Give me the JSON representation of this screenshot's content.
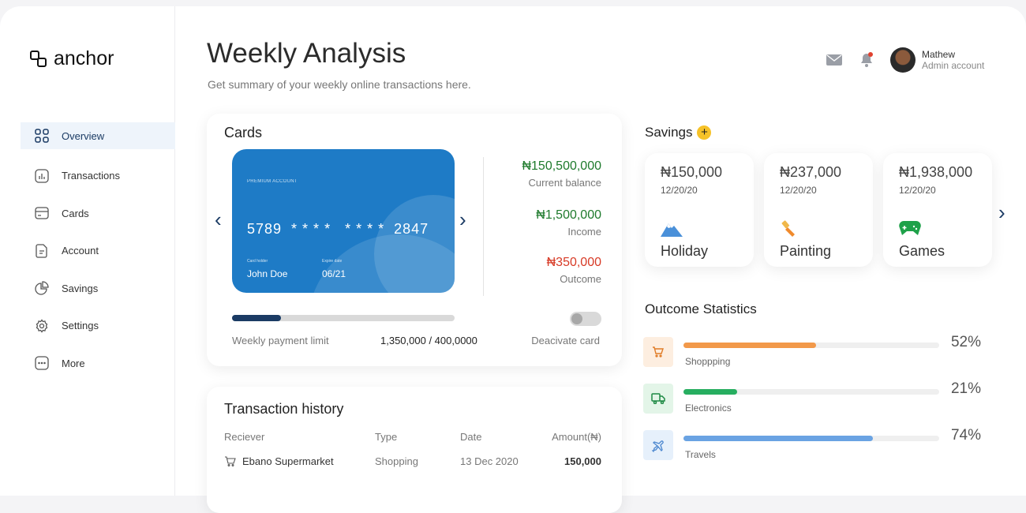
{
  "brand": {
    "name": "anchor"
  },
  "sidebar": {
    "items": [
      {
        "label": "Overview",
        "icon": "grid-icon",
        "active": true
      },
      {
        "label": "Transactions",
        "icon": "bar-chart-icon"
      },
      {
        "label": "Cards",
        "icon": "card-icon"
      },
      {
        "label": "Account",
        "icon": "document-icon"
      },
      {
        "label": "Savings",
        "icon": "pie-chart-icon"
      },
      {
        "label": "Settings",
        "icon": "gear-icon"
      },
      {
        "label": "More",
        "icon": "more-icon"
      }
    ]
  },
  "header": {
    "title": "Weekly Analysis",
    "subtitle": "Get summary of your weekly online transactions here.",
    "user_name": "Mathew",
    "user_role": "Admin account"
  },
  "cards": {
    "title": "Cards",
    "card": {
      "tier": "PREMIUM ACCOUNT",
      "number": "5789  * * * *   * * * *  2847",
      "holder_label": "Card holder",
      "holder": "John Doe",
      "expiry_label": "Expire date",
      "expiry": "06/21"
    },
    "stats": [
      {
        "value": "₦150,500,000",
        "label": "Current balance",
        "color": "#1e7a2c"
      },
      {
        "value": "₦1,500,000",
        "label": "Income",
        "color": "#1e7a2c"
      },
      {
        "value": "₦350,000",
        "label": "Outcome",
        "color": "#d73a26"
      }
    ],
    "limit_label": "Weekly payment limit",
    "limit_value": "1,350,000 / 400,0000",
    "limit_progress": 0.22,
    "deactivate_label": "Deacivate card"
  },
  "transactions": {
    "title": "Transaction history",
    "columns": [
      "Reciever",
      "Type",
      "Date",
      "Amount(₦)"
    ],
    "rows": [
      {
        "receiver": "Ebano Supermarket",
        "type": "Shopping",
        "date": "13 Dec 2020",
        "amount": "150,000"
      }
    ]
  },
  "savings": {
    "title": "Savings",
    "items": [
      {
        "amount": "₦150,000",
        "date": "12/20/20",
        "name": "Holiday",
        "icon": "mountain-icon"
      },
      {
        "amount": "₦237,000",
        "date": "12/20/20",
        "name": "Painting",
        "icon": "paint-brush-icon"
      },
      {
        "amount": "₦1,938,000",
        "date": "12/20/20",
        "name": "Games",
        "icon": "gamepad-icon"
      }
    ]
  },
  "outcome": {
    "title": "Outcome Statistics",
    "items": [
      {
        "label": "Shoppping",
        "percent": "52%",
        "value": 0.52,
        "color": "#f2994a",
        "bg": "#fdeee0",
        "icon": "cart-icon"
      },
      {
        "label": "Electronics",
        "percent": "21%",
        "value": 0.21,
        "color": "#27ae60",
        "bg": "#e3f5e8",
        "icon": "truck-icon"
      },
      {
        "label": "Travels",
        "percent": "74%",
        "value": 0.74,
        "color": "#6aa3e3",
        "bg": "#e6f0fb",
        "icon": "plane-icon"
      }
    ]
  }
}
